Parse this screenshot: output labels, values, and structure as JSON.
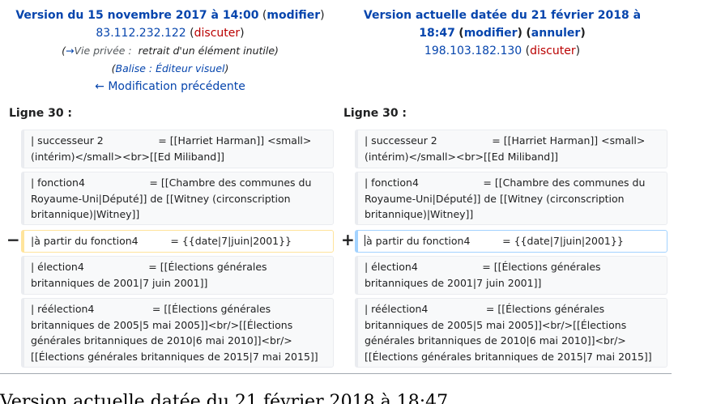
{
  "left": {
    "title": "Version du 15 novembre 2017 à 14:00",
    "modify": "modifier",
    "ip": "83.112.232.122",
    "talk": "discuter",
    "arrow": "→",
    "private": "Vie privée :",
    "summary": "retrait d'un élément inutile",
    "tag_label": "Balise",
    "tag_sep": " : ",
    "tag_value": "Éditeur visuel",
    "prev_link": "← Modification précédente"
  },
  "right": {
    "title_line1": "Version actuelle datée du 21 février 2018 à",
    "title_line2": "18:47",
    "modify": "modifier",
    "undo": "annuler",
    "ip": "198.103.182.130",
    "talk": "discuter"
  },
  "line_label": "Ligne 30 :",
  "markers": {
    "minus": "−",
    "plus": "+"
  },
  "rows": [
    {
      "left": "| successeur 2                 = [[Harriet Harman]] <small>(intérim)</small><br>[[Ed Miliband]]",
      "right": "| successeur 2                 = [[Harriet Harman]] <small>(intérim)</small><br>[[Ed Miliband]]"
    },
    {
      "left": "| fonction4                    = [[Chambre des communes du Royaume-Uni|Député]] de [[Witney (circonscription britannique)|Witney]]",
      "right": "| fonction4                    = [[Chambre des communes du Royaume-Uni|Député]] de [[Witney (circonscription britannique)|Witney]]"
    },
    {
      "left": "|à partir du fonction4          = {{date|7|juin|2001}}",
      "right": "à partir du fonction4          = {{date|7|juin|2001}}"
    },
    {
      "left": "| élection4                    = [[Élections générales britanniques de 2001|7 juin 2001]]",
      "right": "| élection4                    = [[Élections générales britanniques de 2001|7 juin 2001]]"
    },
    {
      "left": "| réélection4                  = [[Élections générales britanniques de 2005|5 mai 2005]]<br/>[[Élections générales britanniques de 2010|6 mai 2010]]<br/> [[Élections générales britanniques de 2015|7 mai 2015]]",
      "right": "| réélection4                  = [[Élections générales britanniques de 2005|5 mai 2005]]<br/>[[Élections générales britanniques de 2010|6 mai 2010]]<br/> [[Élections générales britanniques de 2015|7 mai 2015]]"
    }
  ],
  "footer": "Version actuelle datée du 21 février 2018 à 18:47"
}
